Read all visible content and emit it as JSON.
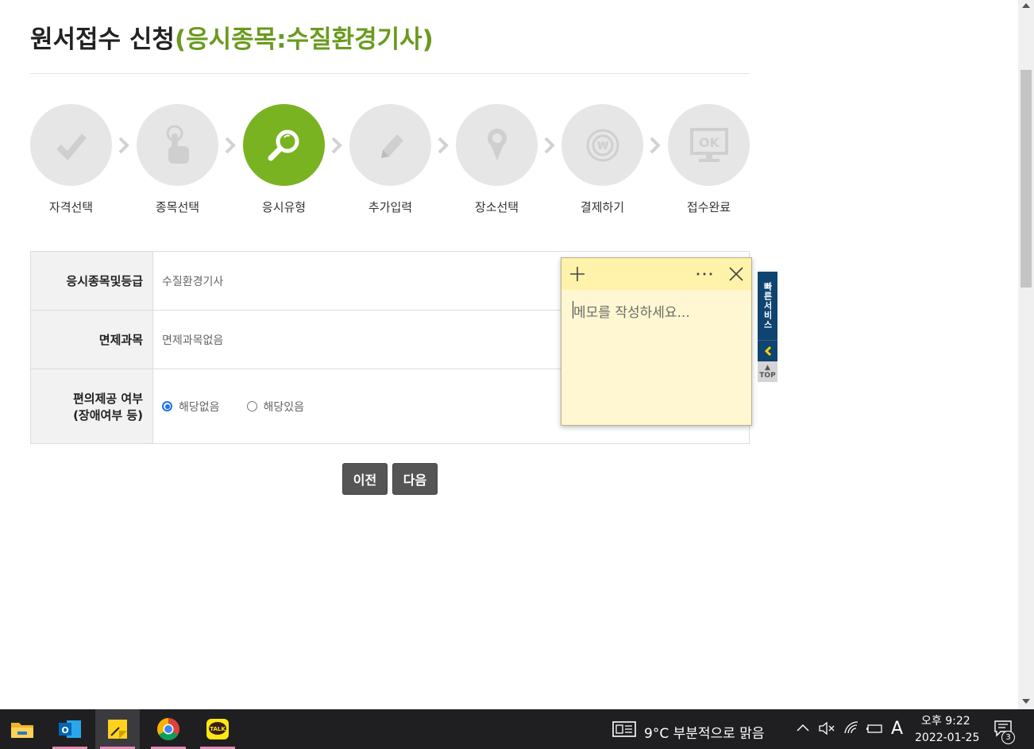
{
  "page": {
    "title_main": "원서접수 신청",
    "title_sub": "(응시종목:수질환경기사)"
  },
  "steps": [
    {
      "label": "자격선택",
      "icon": "check-icon",
      "active": false
    },
    {
      "label": "종목선택",
      "icon": "hand-pointer-icon",
      "active": false
    },
    {
      "label": "응시유형",
      "icon": "search-icon",
      "active": true
    },
    {
      "label": "추가입력",
      "icon": "pencil-icon",
      "active": false
    },
    {
      "label": "장소선택",
      "icon": "location-pin-icon",
      "active": false
    },
    {
      "label": "결제하기",
      "icon": "won-coin-icon",
      "active": false
    },
    {
      "label": "접수완료",
      "icon": "ok-monitor-icon",
      "active": false
    }
  ],
  "form": {
    "row1_label": "응시종목및등급",
    "row1_value": "수질환경기사",
    "row2_label": "면제과목",
    "row2_value": "면제과목없음",
    "row3_label_line1": "편의제공 여부",
    "row3_label_line2": "(장애여부 등)",
    "radio_option1": "해당없음",
    "radio_option2": "해당있음",
    "radio_selected": "해당없음"
  },
  "buttons": {
    "prev": "이전",
    "next": "다음"
  },
  "sticky_note": {
    "placeholder": "메모를 작성하세요..."
  },
  "quick_service": {
    "label": "빠른서비스",
    "top": "TOP"
  },
  "taskbar": {
    "weather": "9°C  부분적으로 맑음",
    "ime": "A",
    "time": "오후 9:22",
    "date": "2022-01-25",
    "notification_count": "3"
  },
  "colors": {
    "accent_green": "#79b322",
    "title_green": "#6a9a1f",
    "quick_navy": "#0f4470",
    "note_yellow": "#fff7d1"
  }
}
